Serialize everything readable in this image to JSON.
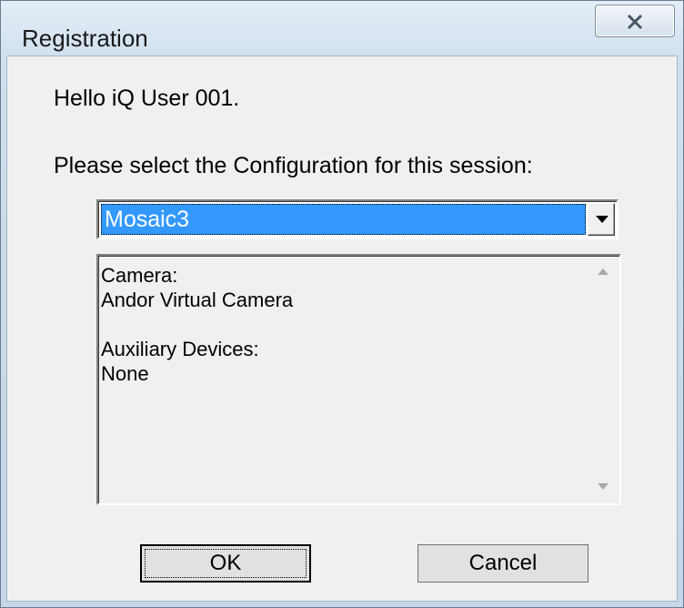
{
  "window": {
    "title": "Registration"
  },
  "dialog": {
    "greeting": "Hello iQ User 001.",
    "prompt": "Please select the Configuration for this session:",
    "configuration": {
      "selected": "Mosaic3"
    },
    "details": {
      "lines": [
        "Camera:",
        "Andor Virtual Camera",
        "",
        "Auxiliary Devices:",
        "None"
      ]
    },
    "buttons": {
      "ok_label": "OK",
      "cancel_label": "Cancel"
    }
  },
  "icons": {
    "close": "close-icon",
    "dropdown": "chevron-down-icon",
    "scroll_up": "scroll-up-arrow-icon",
    "scroll_down": "scroll-down-arrow-icon"
  },
  "colors": {
    "selection": "#3399ff",
    "dialog_background": "#f0f0f0",
    "frame": "#c4d6e8"
  }
}
